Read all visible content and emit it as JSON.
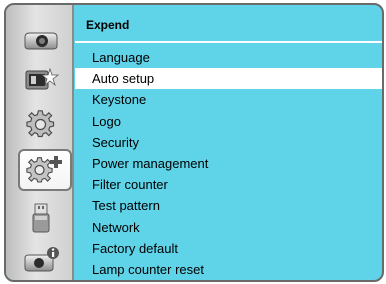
{
  "menu_title": "Expend",
  "sidebar": {
    "items": [
      {
        "icon": "projector-icon"
      },
      {
        "icon": "picture-adjust-icon"
      },
      {
        "icon": "gear-icon"
      },
      {
        "icon": "gear-plus-icon",
        "active": true
      },
      {
        "icon": "usb-icon"
      },
      {
        "icon": "info-icon"
      }
    ]
  },
  "menu": {
    "items": [
      "Language",
      "Auto setup",
      "Keystone",
      "Logo",
      "Security",
      "Power management",
      "Filter counter",
      "Test pattern",
      "Network",
      "Factory default",
      "Lamp counter reset"
    ],
    "selected": "Auto setup"
  },
  "colors": {
    "panel_bg": "#5fd3e8",
    "highlight": "#ffffff",
    "sidebar": "#d6d6d6"
  }
}
